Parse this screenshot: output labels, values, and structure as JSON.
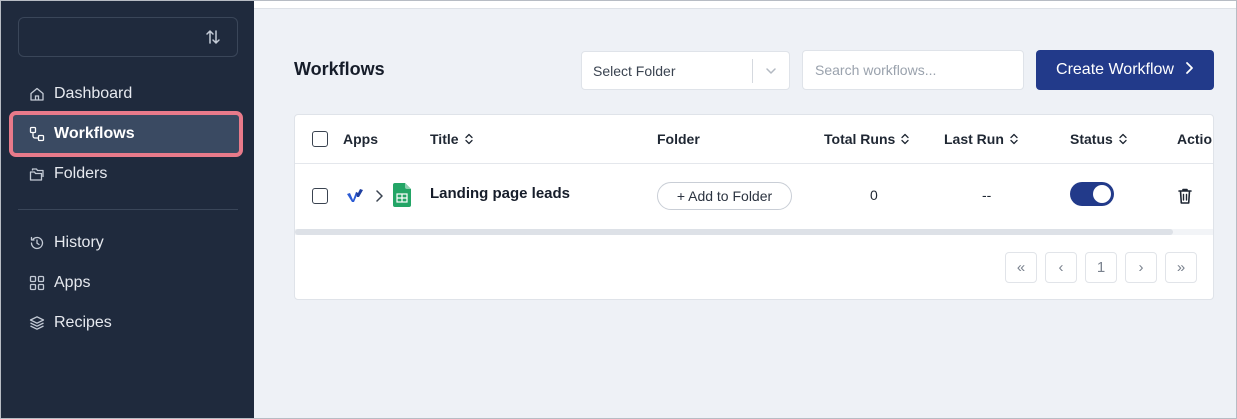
{
  "sidebar": {
    "items_top": [
      {
        "label": "Dashboard",
        "icon": "home-icon"
      },
      {
        "label": "Workflows",
        "icon": "workflow-icon",
        "active": true
      },
      {
        "label": "Folders",
        "icon": "folders-icon"
      }
    ],
    "items_bottom": [
      {
        "label": "History",
        "icon": "history-icon"
      },
      {
        "label": "Apps",
        "icon": "apps-grid-icon"
      },
      {
        "label": "Recipes",
        "icon": "layers-icon"
      }
    ]
  },
  "header": {
    "title": "Workflows",
    "folder_select": {
      "value": "Select Folder"
    },
    "search": {
      "placeholder": "Search workflows..."
    },
    "create_button": "Create Workflow"
  },
  "table": {
    "columns": [
      "Apps",
      "Title",
      "Folder",
      "Total Runs",
      "Last Run",
      "Status",
      "Actio"
    ],
    "rows": [
      {
        "title": "Landing page leads",
        "folder_button": "+ Add to Folder",
        "total_runs": "0",
        "last_run": "--",
        "status_on": true
      }
    ]
  },
  "pagination": {
    "first": "«",
    "prev": "‹",
    "current": "1",
    "next": "›",
    "last": "»"
  },
  "colors": {
    "sidebar_bg": "#1f2a3d",
    "accent": "#223a8a",
    "highlight_outline": "#e87a8a",
    "content_bg": "#eef1f6"
  }
}
